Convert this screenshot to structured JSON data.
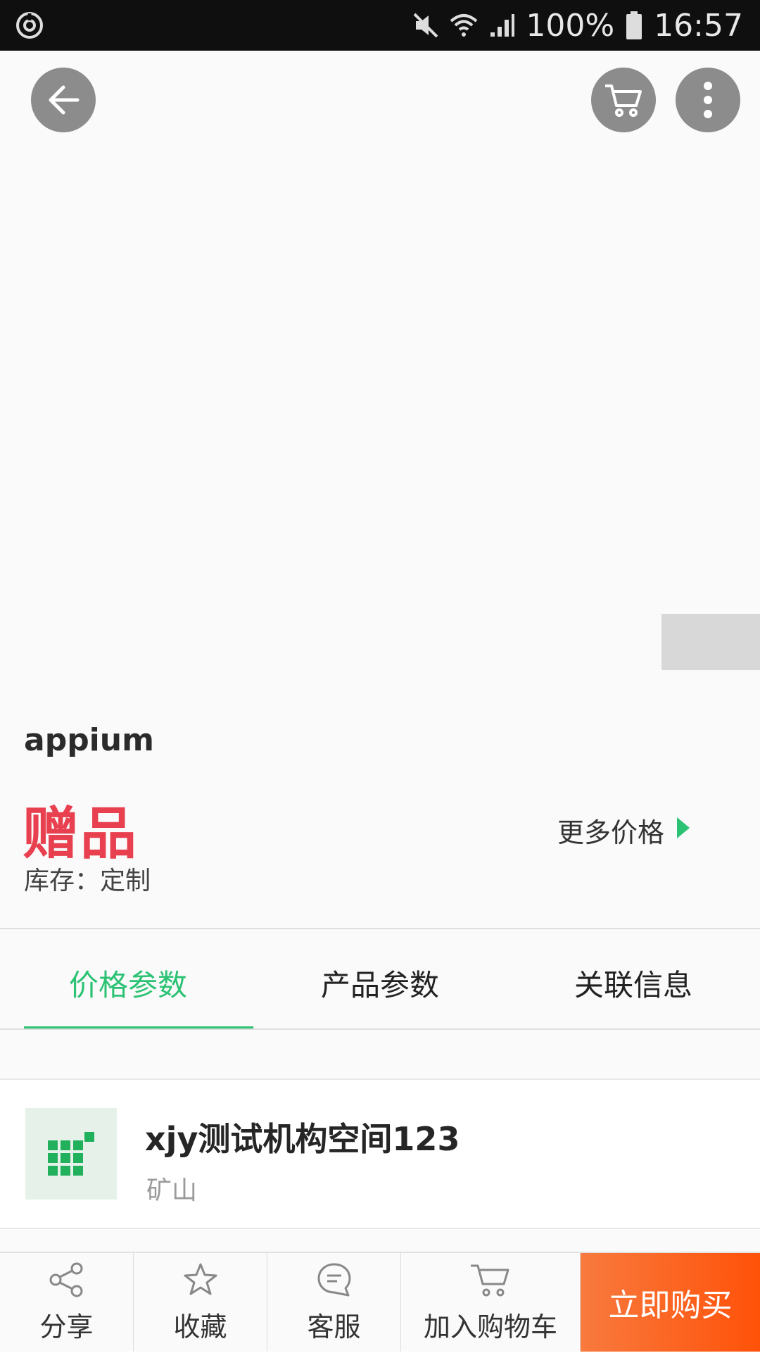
{
  "status_bar": {
    "battery": "100%",
    "time": "16:57"
  },
  "top_actions": {
    "back": "back-arrow-icon",
    "cart": "cart-icon",
    "more": "more-vertical-icon"
  },
  "product": {
    "title": "appium",
    "price_label": "赠品",
    "more_price": "更多价格",
    "stock": "库存：定制"
  },
  "tabs": [
    {
      "label": "价格参数",
      "active": true
    },
    {
      "label": "产品参数",
      "active": false
    },
    {
      "label": "关联信息",
      "active": false
    }
  ],
  "seller": {
    "name": "xjy测试机构空间123",
    "location": "矿山"
  },
  "bottom_bar": {
    "items": [
      {
        "label": "分享",
        "icon": "share-icon"
      },
      {
        "label": "收藏",
        "icon": "star-icon"
      },
      {
        "label": "客服",
        "icon": "chat-icon"
      },
      {
        "label": "加入购物车",
        "icon": "cart-icon"
      }
    ],
    "buy_label": "立即购买"
  },
  "colors": {
    "accent_green": "#2cc274",
    "price_red": "#e8404f",
    "buy_orange": "#ff5209"
  }
}
